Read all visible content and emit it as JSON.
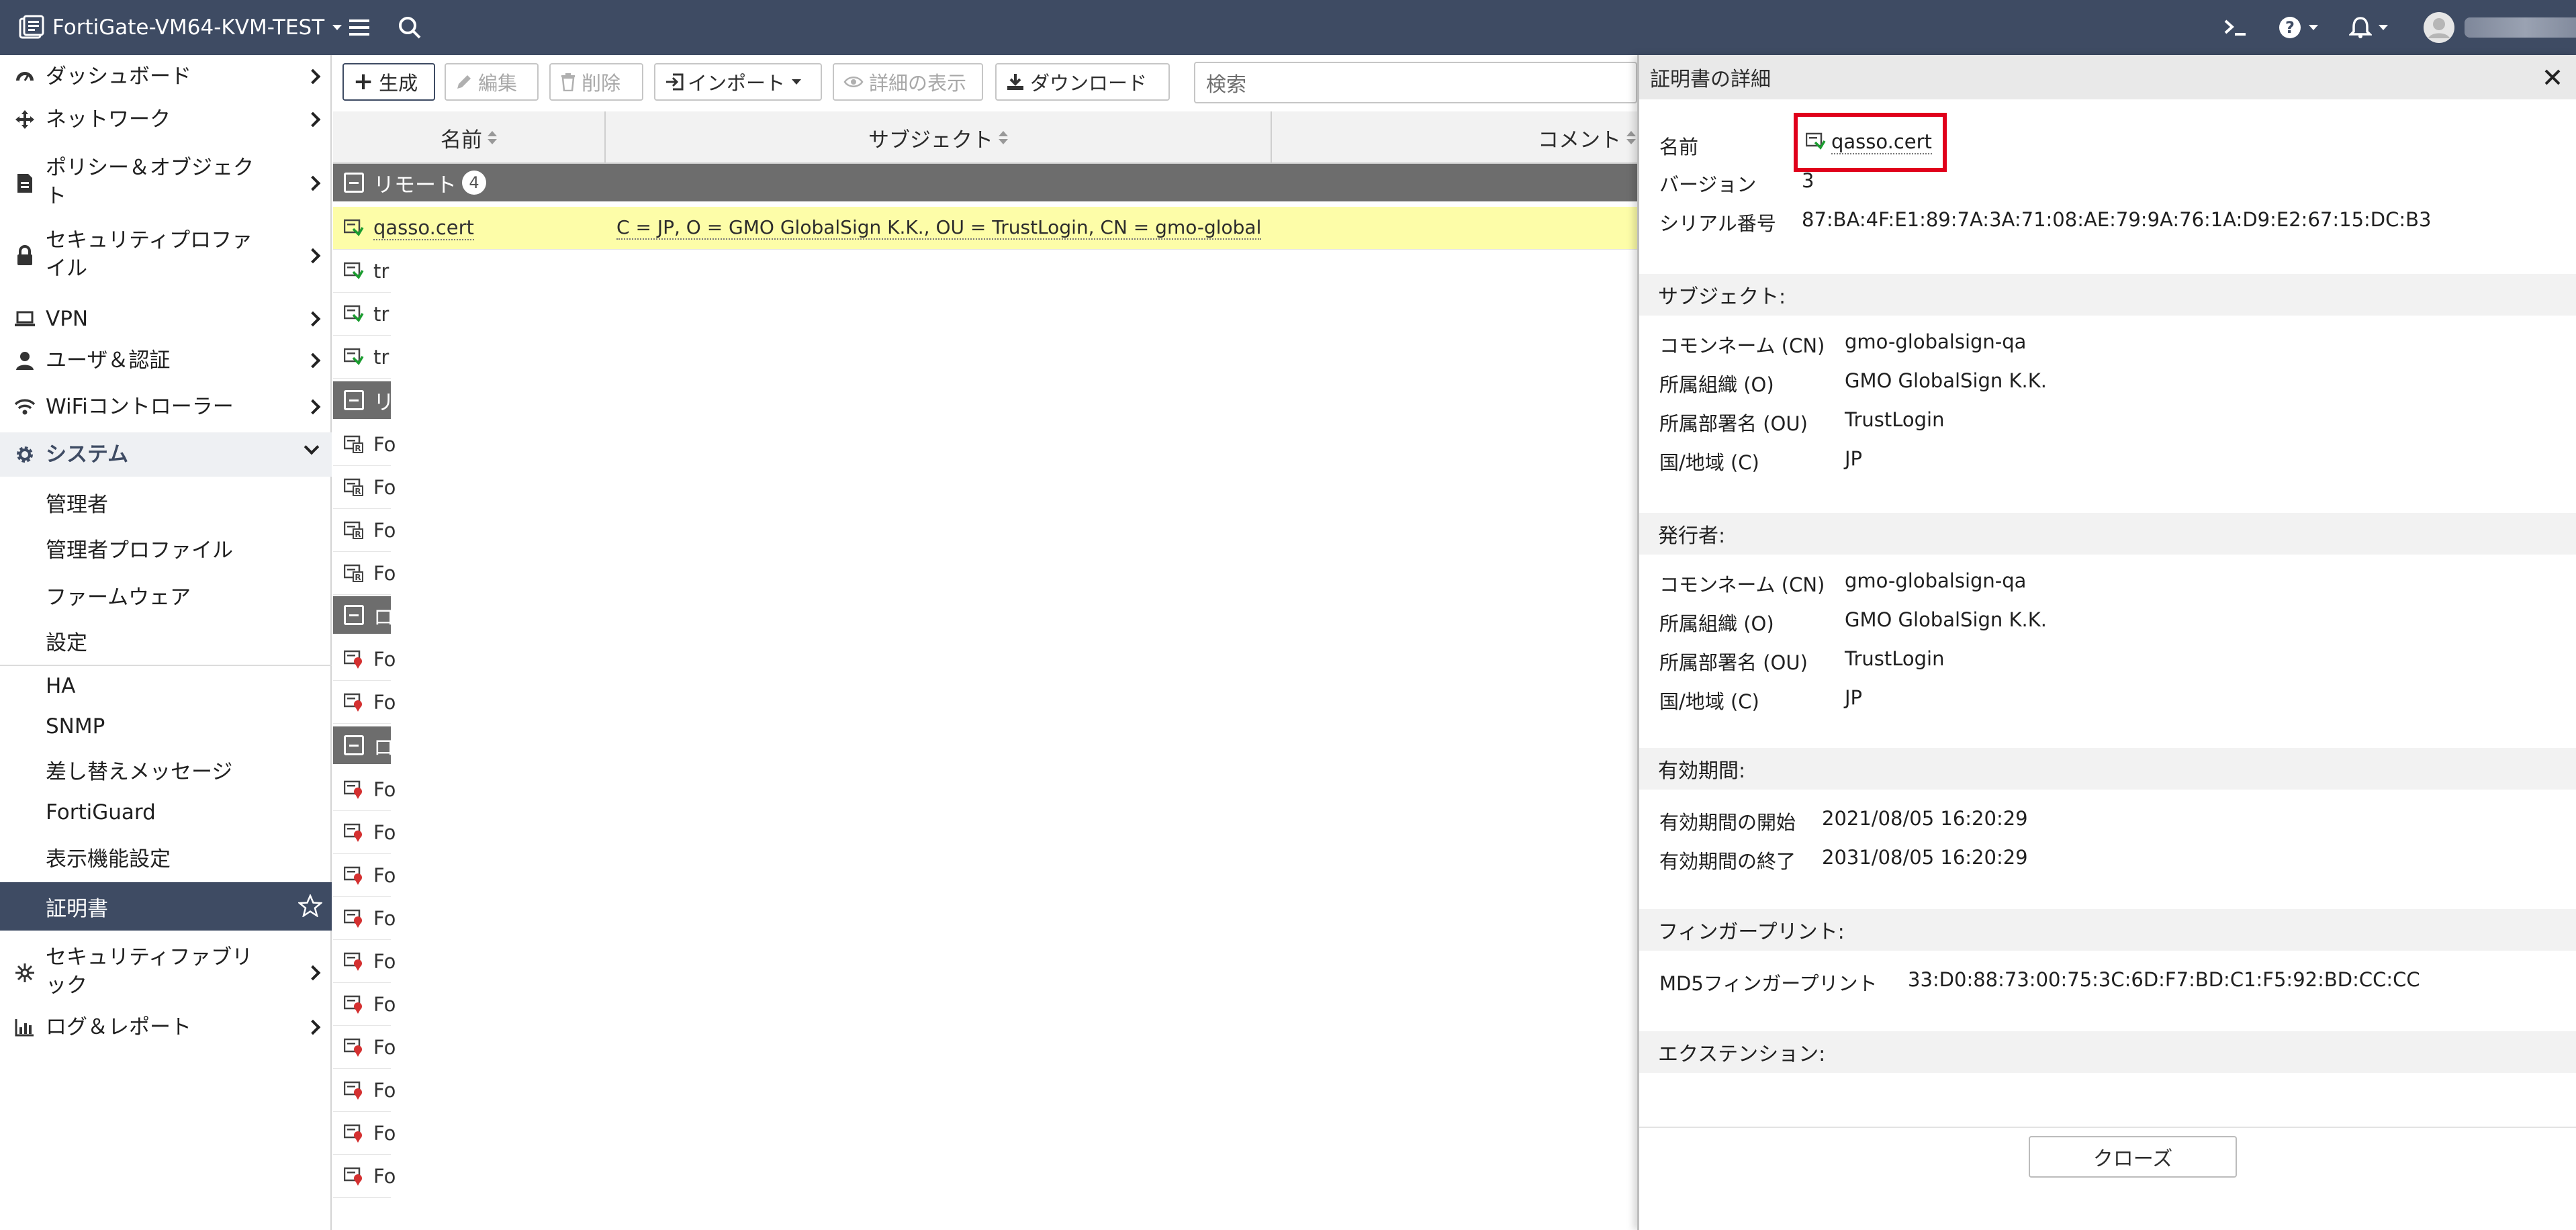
{
  "header": {
    "device_name": "FortiGate-VM64-KVM-TEST"
  },
  "sidebar": {
    "items": [
      {
        "label": "ダッシュボード"
      },
      {
        "label": "ネットワーク"
      },
      {
        "label": "ポリシー＆オブジェク",
        "label2": "ト"
      },
      {
        "label": "セキュリティプロファ",
        "label2": "イル"
      },
      {
        "label": "VPN"
      },
      {
        "label": "ユーザ＆認証"
      },
      {
        "label": "WiFiコントローラー"
      },
      {
        "label": "システム"
      },
      {
        "label": "セキュリティファブリ",
        "label2": "ック"
      },
      {
        "label": "ログ＆レポート"
      }
    ],
    "system_sub": [
      "管理者",
      "管理者プロファイル",
      "ファームウェア",
      "設定",
      "HA",
      "SNMP",
      "差し替えメッセージ",
      "FortiGuard",
      "表示機能設定"
    ],
    "certificates": "証明書"
  },
  "toolbar": {
    "create": "生成",
    "edit": "編集",
    "delete": "削除",
    "import": "インポート",
    "view_details": "詳細の表示",
    "download": "ダウンロード",
    "search_placeholder": "検索"
  },
  "table": {
    "columns": [
      "名前",
      "サブジェクト",
      "コメント"
    ],
    "group_remote": {
      "label": "リモート",
      "count": "4"
    },
    "group_partial_label": "リ",
    "group_partial_label2": "ロ",
    "group_partial_label3": "ロ",
    "selected_row": {
      "name": "qasso.cert",
      "subject": "C = JP, O = GMO GlobalSign K.K., OU = TrustLogin, CN = gmo-globalsign..."
    },
    "truncated_rows": [
      "tr",
      "tr",
      "tr",
      "Fo",
      "Fo",
      "Fo",
      "Fo",
      "Fo",
      "Fo",
      "Fo",
      "Fo",
      "Fo",
      "Fo",
      "Fo",
      "Fo",
      "Fo",
      "Fo",
      "Fo",
      "Fo"
    ]
  },
  "panel": {
    "title": "証明書の詳細",
    "name_label": "名前",
    "name_value": "qasso.cert",
    "version_label": "バージョン",
    "version_value": "3",
    "serial_label": "シリアル番号",
    "serial_value": "87:BA:4F:E1:89:7A:3A:71:08:AE:79:9A:76:1A:D9:E2:67:15:DC:B3",
    "subject_section": "サブジェクト:",
    "subject": [
      {
        "k": "コモンネーム (CN)",
        "v": "gmo-globalsign-qa"
      },
      {
        "k": "所属組織 (O)",
        "v": "GMO GlobalSign K.K."
      },
      {
        "k": "所属部署名 (OU)",
        "v": "TrustLogin"
      },
      {
        "k": "国/地域 (C)",
        "v": "JP"
      }
    ],
    "issuer_section": "発行者:",
    "issuer": [
      {
        "k": "コモンネーム (CN)",
        "v": "gmo-globalsign-qa"
      },
      {
        "k": "所属組織 (O)",
        "v": "GMO GlobalSign K.K."
      },
      {
        "k": "所属部署名 (OU)",
        "v": "TrustLogin"
      },
      {
        "k": "国/地域 (C)",
        "v": "JP"
      }
    ],
    "validity_section": "有効期間:",
    "valid_from_label": "有効期間の開始",
    "valid_from": "2021/08/05 16:20:29",
    "valid_to_label": "有効期間の終了",
    "valid_to": "2031/08/05 16:20:29",
    "fingerprint_section": "フィンガープリント:",
    "md5_label": "MD5フィンガープリント",
    "md5_value": "33:D0:88:73:00:75:3C:6D:F7:BD:C1:F5:92:BD:CC:CC",
    "extension_section": "エクステンション:",
    "close_button": "クローズ"
  },
  "colors": {
    "topbar": "#3e4b63",
    "highlight_row": "#fdfda8",
    "callout_red": "#e0001b"
  }
}
